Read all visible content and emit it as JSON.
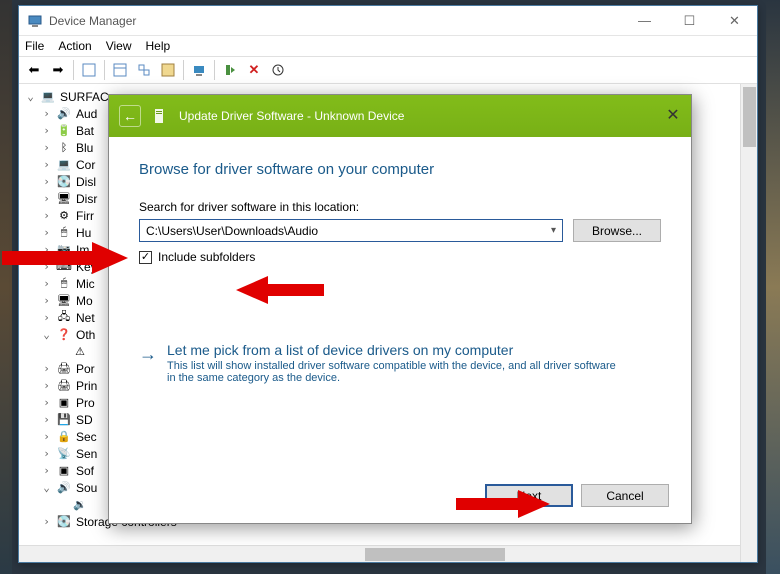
{
  "window": {
    "title": "Device Manager",
    "menus": [
      "File",
      "Action",
      "View",
      "Help"
    ],
    "toolbar_buttons": [
      "back",
      "forward",
      "up",
      "show-hidden",
      "properties",
      "refresh",
      "remove",
      "scan"
    ],
    "winbtns": {
      "min": "—",
      "max": "☐",
      "close": "✕"
    }
  },
  "tree": {
    "root": "SURFAC",
    "items": [
      {
        "label": "Aud",
        "icon": "🔊"
      },
      {
        "label": "Bat",
        "icon": "🔋"
      },
      {
        "label": "Blu",
        "icon": "ᛒ"
      },
      {
        "label": "Cor",
        "icon": "💻"
      },
      {
        "label": "Disl",
        "icon": "💽"
      },
      {
        "label": "Disr",
        "icon": "🖥"
      },
      {
        "label": "Firr",
        "icon": "⚙"
      },
      {
        "label": "Hu",
        "icon": "🖱"
      },
      {
        "label": "Im",
        "icon": "📷"
      },
      {
        "label": "Key",
        "icon": "⌨"
      },
      {
        "label": "Mic",
        "icon": "🖱"
      },
      {
        "label": "Mo",
        "icon": "🖥"
      },
      {
        "label": "Net",
        "icon": "🖧"
      },
      {
        "label": "Oth",
        "icon": "❓",
        "expanded": true,
        "children": [
          {
            "label": "",
            "icon": "⚠"
          }
        ]
      },
      {
        "label": "Por",
        "icon": "🖨"
      },
      {
        "label": "Prin",
        "icon": "🖨"
      },
      {
        "label": "Pro",
        "icon": "▣"
      },
      {
        "label": "SD",
        "icon": "💾"
      },
      {
        "label": "Sec",
        "icon": "🔒"
      },
      {
        "label": "Sen",
        "icon": "📡"
      },
      {
        "label": "Sof",
        "icon": "▣"
      },
      {
        "label": "Sou",
        "icon": "🔊",
        "expanded": true,
        "children": [
          {
            "label": "",
            "icon": "🔉"
          }
        ]
      },
      {
        "label": "Storage controllers",
        "icon": "💽"
      }
    ]
  },
  "dialog": {
    "title": "Update Driver Software - Unknown Device",
    "heading": "Browse for driver software on your computer",
    "search_label": "Search for driver software in this location:",
    "path_value": "C:\\Users\\User\\Downloads\\Audio",
    "browse_label": "Browse...",
    "include_subfolders_label": "Include subfolders",
    "include_subfolders_checked": true,
    "link_title": "Let me pick from a list of device drivers on my computer",
    "link_desc": "This list will show installed driver software compatible with the device, and all driver software in the same category as the device.",
    "next_label": "Next",
    "cancel_label": "Cancel"
  }
}
